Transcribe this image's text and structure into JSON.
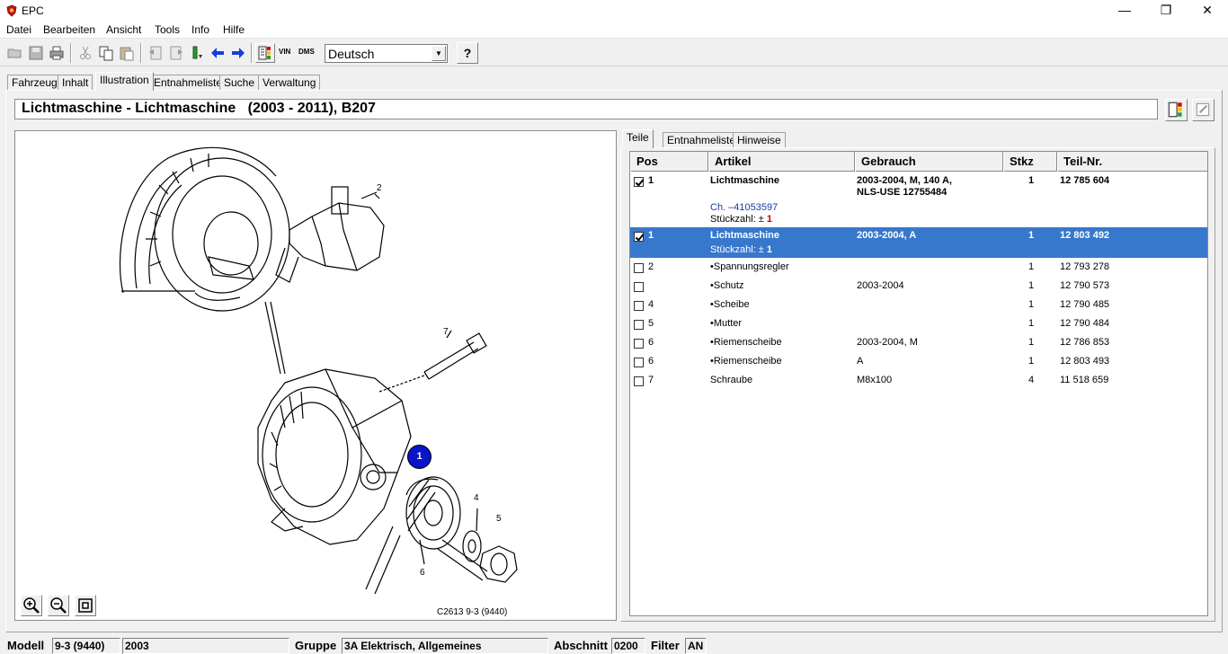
{
  "window": {
    "title": "EPC",
    "minimize": "—",
    "restore": "❐",
    "close": "✕"
  },
  "menu": [
    "Datei",
    "Bearbeiten",
    "Ansicht",
    "Tools",
    "Info",
    "Hilfe"
  ],
  "toolbar": {
    "language": "Deutsch",
    "vin_label": "VIN",
    "dms_label": "DMS",
    "help_label": "?"
  },
  "main_tabs": [
    "Fahrzeug",
    "Inhalt",
    "Illustration",
    "Entnahmeliste",
    "Suche",
    "Verwaltung"
  ],
  "header": {
    "title": "Lichtmaschine - Lichtmaschine   (2003 - 2011), B207"
  },
  "illustration": {
    "caption": "C2613 9-3 (9440)",
    "callouts": [
      "2",
      "7",
      "4",
      "5",
      "6"
    ],
    "selected_badge": "1"
  },
  "sub_tabs": [
    "Teile",
    "Entnahmeliste",
    "Hinweise"
  ],
  "parts_table": {
    "columns": [
      "Pos",
      "Artikel",
      "Gebrauch",
      "Stkz",
      "Teil-Nr."
    ],
    "rows": [
      {
        "checked": true,
        "pos": "1",
        "artikel": "Lichtmaschine",
        "gebrauch": "2003-2004, M, 140 A,",
        "gebrauch2": "NLS-USE 12755484",
        "stkz": "1",
        "teilnr": "12 785 604",
        "bold": true,
        "note": "Ch. –41053597",
        "qty_label": "Stückzahl: ±",
        "qty_value": "1"
      },
      {
        "checked": true,
        "pos": "1",
        "artikel": "Lichtmaschine",
        "gebrauch": "2003-2004, A",
        "stkz": "1",
        "teilnr": "12 803 492",
        "bold": true,
        "selected": true,
        "qty_label": "Stückzahl: ±",
        "qty_value": "1"
      },
      {
        "checked": false,
        "pos": "2",
        "artikel": "•Spannungsregler",
        "gebrauch": "",
        "stkz": "1",
        "teilnr": "12 793 278"
      },
      {
        "checked": false,
        "pos": "",
        "artikel": "•Schutz",
        "gebrauch": "2003-2004",
        "stkz": "1",
        "teilnr": "12 790 573"
      },
      {
        "checked": false,
        "pos": "4",
        "artikel": "•Scheibe",
        "gebrauch": "",
        "stkz": "1",
        "teilnr": "12 790 485"
      },
      {
        "checked": false,
        "pos": "5",
        "artikel": "•Mutter",
        "gebrauch": "",
        "stkz": "1",
        "teilnr": "12 790 484"
      },
      {
        "checked": false,
        "pos": "6",
        "artikel": "•Riemenscheibe",
        "gebrauch": "2003-2004, M",
        "stkz": "1",
        "teilnr": "12 786 853"
      },
      {
        "checked": false,
        "pos": "6",
        "artikel": "•Riemenscheibe",
        "gebrauch": "A",
        "stkz": "1",
        "teilnr": "12 803 493"
      },
      {
        "checked": false,
        "pos": "7",
        "artikel": "Schraube",
        "gebrauch": "M8x100",
        "stkz": "4",
        "teilnr": "11 518 659"
      }
    ]
  },
  "status": {
    "modell_label": "Modell",
    "modell_value": "9-3 (9440)",
    "year_value": "2003",
    "gruppe_label": "Gruppe",
    "gruppe_value": "3A Elektrisch, Allgemeines",
    "abschnitt_label": "Abschnitt",
    "abschnitt_value": "0200",
    "filter_label": "Filter",
    "filter_value": "AN"
  },
  "colors": {
    "selection": "#3778cc",
    "badge": "#0a14c8",
    "qty_red": "#d40000"
  }
}
